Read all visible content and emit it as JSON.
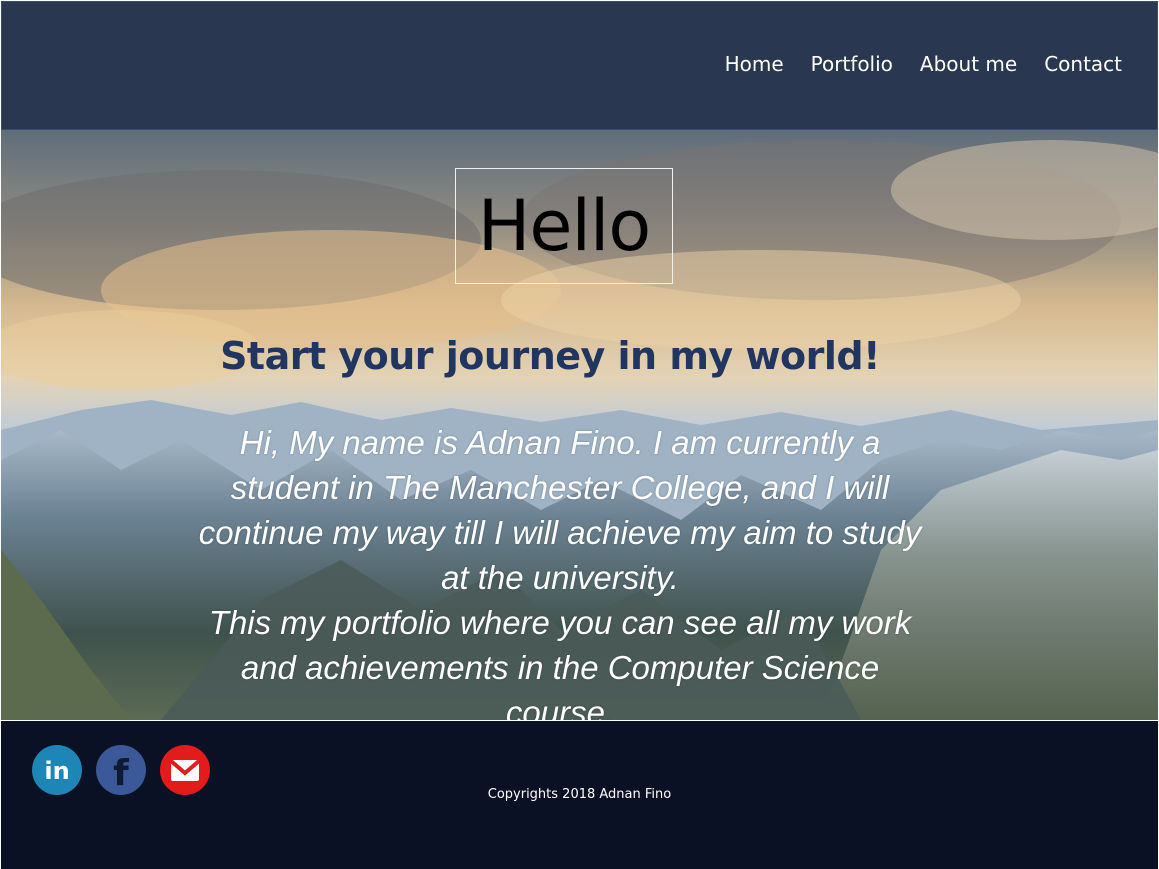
{
  "nav": {
    "items": [
      {
        "label": "Home"
      },
      {
        "label": "Portfolio"
      },
      {
        "label": "About me"
      },
      {
        "label": "Contact"
      }
    ]
  },
  "hero": {
    "greeting": "Hello",
    "tagline": "Start your journey in my world!",
    "intro_line1": "Hi, My name is Adnan Fino. I am currently a student in The Manchester College, and I will continue my way till I will achieve my aim to study at the university.",
    "intro_line2": "This my portfolio where you can see all my work and achievements in the Computer Science course."
  },
  "footer": {
    "social": [
      {
        "icon": "linkedin-icon",
        "glyph": "in",
        "color": "#1e86b7"
      },
      {
        "icon": "facebook-icon",
        "glyph": "f",
        "color": "#3b5998"
      },
      {
        "icon": "mail-icon",
        "glyph": "✉",
        "color": "#e41b1b"
      }
    ],
    "copyright": "Copyrights 2018 Adnan Fino"
  },
  "colors": {
    "header_bg": "#293750",
    "footer_bg": "#0a1124",
    "tagline": "#20355f"
  }
}
